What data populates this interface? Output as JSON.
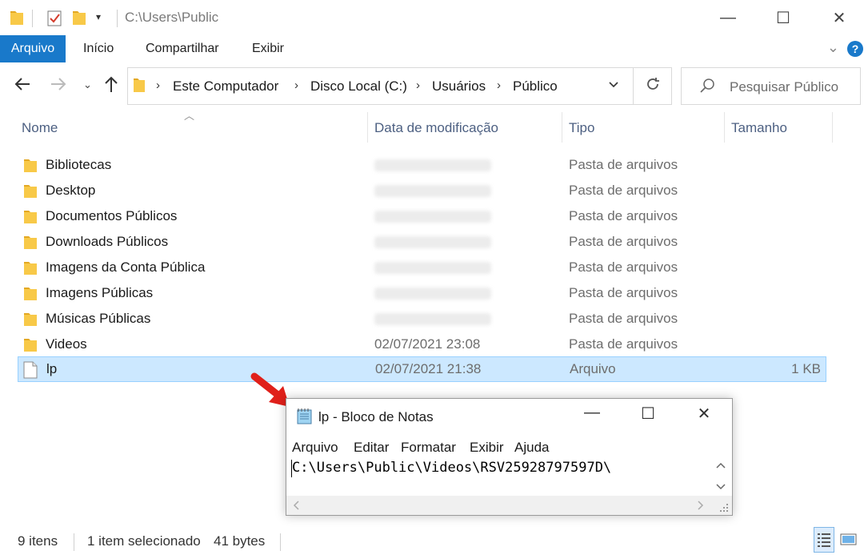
{
  "window": {
    "title": "C:\\Users\\Public",
    "minimize": "—",
    "maximize": "☐",
    "close": "✕"
  },
  "ribbon": {
    "tabs": [
      "Arquivo",
      "Início",
      "Compartilhar",
      "Exibir"
    ],
    "help": "?"
  },
  "nav": {
    "breadcrumbs": [
      "Este Computador",
      "Disco Local (C:)",
      "Usuários",
      "Público"
    ],
    "search_placeholder": "Pesquisar Público"
  },
  "columns": {
    "name": "Nome",
    "date": "Data de modificação",
    "type": "Tipo",
    "size": "Tamanho"
  },
  "files": [
    {
      "name": "Bibliotecas",
      "date": "",
      "type": "Pasta de arquivos",
      "size": "",
      "icon": "folder-icon"
    },
    {
      "name": "Desktop",
      "date": "",
      "type": "Pasta de arquivos",
      "size": "",
      "icon": "folder-icon"
    },
    {
      "name": "Documentos Públicos",
      "date": "",
      "type": "Pasta de arquivos",
      "size": "",
      "icon": "folder-icon"
    },
    {
      "name": "Downloads Públicos",
      "date": "",
      "type": "Pasta de arquivos",
      "size": "",
      "icon": "folder-icon"
    },
    {
      "name": "Imagens da Conta Pública",
      "date": "",
      "type": "Pasta de arquivos",
      "size": "",
      "icon": "folder-icon"
    },
    {
      "name": "Imagens Públicas",
      "date": "",
      "type": "Pasta de arquivos",
      "size": "",
      "icon": "folder-icon"
    },
    {
      "name": "Músicas Públicas",
      "date": "",
      "type": "Pasta de arquivos",
      "size": "",
      "icon": "folder-icon"
    },
    {
      "name": "Videos",
      "date": "02/07/2021 23:08",
      "type": "Pasta de arquivos",
      "size": "",
      "icon": "folder-icon"
    },
    {
      "name": "lp",
      "date": "02/07/2021 21:38",
      "type": "Arquivo",
      "size": "1 KB",
      "icon": "file-icon",
      "selected": true
    }
  ],
  "notepad": {
    "title": "lp - Bloco de Notas",
    "menu": [
      "Arquivo",
      "Editar",
      "Formatar",
      "Exibir",
      "Ajuda"
    ],
    "content": "C:\\Users\\Public\\Videos\\RSV25928797597D\\"
  },
  "status": {
    "count": "9 itens",
    "selected": "1 item selecionado",
    "bytes": "41 bytes"
  },
  "colors": {
    "accent": "#1979ca",
    "selection": "#cce8ff",
    "folder": "#f8c948",
    "pointer_arrow": "#e0201a"
  }
}
